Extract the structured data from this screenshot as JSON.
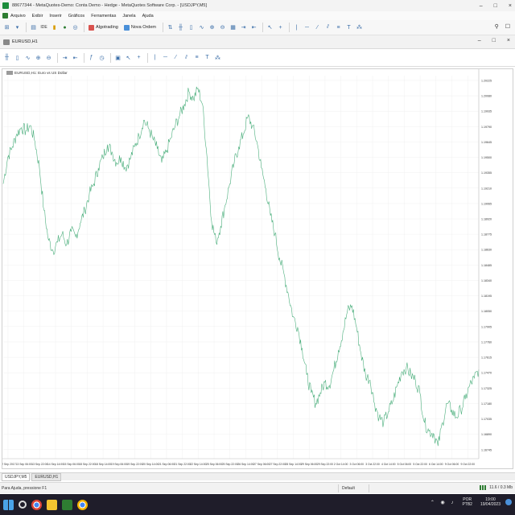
{
  "window": {
    "title": "88677344 - MetaQuotes-Demo: Conta Demo - Hedge - MetaQuotes Software Corp. - [USDJPY,M5]",
    "controls": [
      "–",
      "□",
      "×"
    ]
  },
  "menu": [
    "Arquivo",
    "Exibir",
    "Inserir",
    "Gráficos",
    "Ferramentas",
    "Janela",
    "Ajuda"
  ],
  "toolbar": {
    "algotrading_label": "Algotrading",
    "new_order_label": "Nova Ordem"
  },
  "chart_window": {
    "name": "EURUSD,H1",
    "controls": [
      "–",
      "□",
      "×"
    ],
    "legend": "EURUSD,H1: Euro vs US Dollar"
  },
  "colors": {
    "line": "#4caf7d",
    "grid": "#f0f0f0",
    "axis_text": "#333333"
  },
  "chart_data": {
    "type": "line",
    "symbol": "EURUSD",
    "timeframe": "H1",
    "y_ticks": [
      "1.20225",
      "1.20080",
      "1.19935",
      "1.19790",
      "1.19645",
      "1.19500",
      "1.19355",
      "1.19210",
      "1.19065",
      "1.18920",
      "1.18775",
      "1.18630",
      "1.18485",
      "1.18340",
      "1.18195",
      "1.18050",
      "1.17905",
      "1.17760",
      "1.17615",
      "1.17470",
      "1.17325",
      "1.17180",
      "1.17035",
      "1.16890",
      "1.16745"
    ],
    "x_ticks": [
      "12 Sep 2017",
      "13 Sep 06:00",
      "13 Sep 22:00",
      "14 Sep 14:00",
      "15 Sep 06:00",
      "15 Sep 22:00",
      "18 Sep 14:00",
      "19 Sep 06:00",
      "19 Sep 22:00",
      "20 Sep 14:00",
      "21 Sep 06:00",
      "21 Sep 22:00",
      "22 Sep 14:00",
      "25 Sep 06:00",
      "25 Sep 22:00",
      "26 Sep 14:00",
      "27 Sep 06:00",
      "27 Sep 22:00",
      "28 Sep 14:00",
      "29 Sep 06:00",
      "29 Sep 22:00",
      "2 Oct 14:00",
      "3 Oct 06:00",
      "3 Oct 22:00",
      "4 Oct 14:00",
      "5 Oct 06:00",
      "5 Oct 22:00",
      "6 Oct 14:00",
      "9 Oct 06:00",
      "9 Oct 22:00"
    ],
    "ylim": [
      1.1666,
      1.2027
    ],
    "values": [
      1.1925,
      1.195,
      1.196,
      1.1972,
      1.1978,
      1.1975,
      1.198,
      1.1965,
      1.194,
      1.19,
      1.1872,
      1.1862,
      1.187,
      1.1878,
      1.1868,
      1.188,
      1.1875,
      1.1888,
      1.19,
      1.1915,
      1.1925,
      1.194,
      1.195,
      1.1962,
      1.1955,
      1.1945,
      1.195,
      1.194,
      1.1948,
      1.196,
      1.197,
      1.1985,
      1.1978,
      1.1968,
      1.1958,
      1.1945,
      1.1955,
      1.1968,
      1.198,
      1.199,
      1.2,
      1.2012,
      1.2005,
      1.2015,
      1.2,
      1.195,
      1.189,
      1.187,
      1.1885,
      1.1905,
      1.1925,
      1.1945,
      1.196,
      1.1972,
      1.1988,
      1.198,
      1.1965,
      1.194,
      1.192,
      1.1895,
      1.1878,
      1.1855,
      1.184,
      1.182,
      1.18,
      1.179,
      1.177,
      1.1745,
      1.1728,
      1.1718,
      1.1728,
      1.1738,
      1.1735,
      1.175,
      1.1768,
      1.1785,
      1.1805,
      1.181,
      1.179,
      1.1765,
      1.1745,
      1.174,
      1.1718,
      1.1705,
      1.17,
      1.171,
      1.172,
      1.1735,
      1.1748,
      1.1752,
      1.1745,
      1.174,
      1.1728,
      1.17,
      1.1692,
      1.169,
      1.1678,
      1.17,
      1.1718,
      1.1712,
      1.1705,
      1.1712,
      1.1722,
      1.1735,
      1.1742,
      1.175
    ]
  },
  "tabs": [
    "USDJPY,M5",
    "EURUSD,H1"
  ],
  "status": {
    "help": "Para Ajuda, pressione F1",
    "profile": "Default",
    "connection": "11.6 / 0.3 Mb"
  },
  "taskbar": {
    "lang": "POR",
    "lang2": "PTB2",
    "time": "19:00",
    "date": "19/04/2023"
  }
}
